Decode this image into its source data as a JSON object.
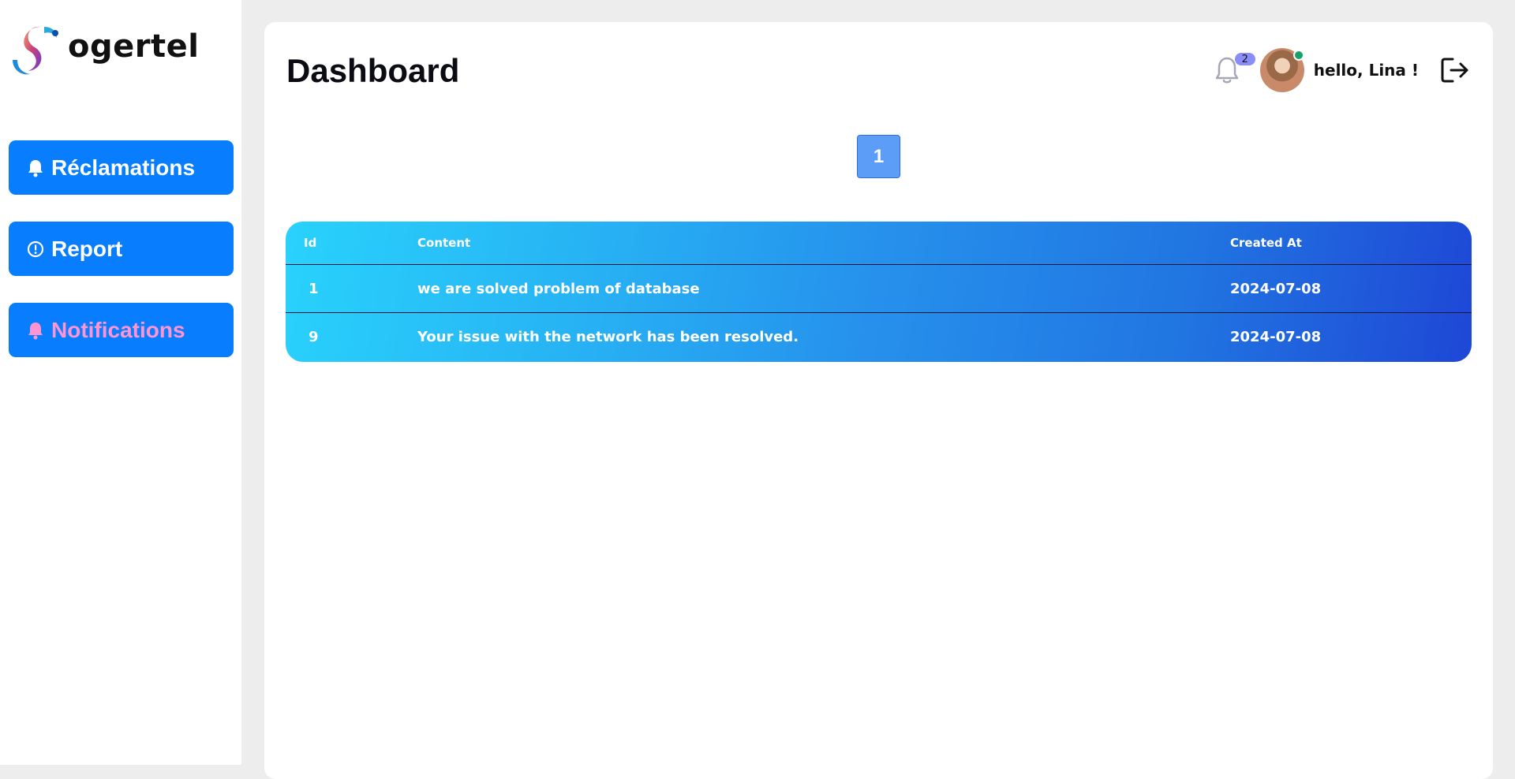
{
  "brand": {
    "name": "ogertel"
  },
  "sidebar": {
    "items": [
      {
        "label": "Réclamations",
        "icon": "bell-icon",
        "active": false
      },
      {
        "label": "Report",
        "icon": "exclamation-circle-icon",
        "active": false
      },
      {
        "label": "Notifications",
        "icon": "bell-icon",
        "active": true
      }
    ]
  },
  "header": {
    "title": "Dashboard",
    "notification_count": "2",
    "greeting": "hello, Lina !"
  },
  "pagination": {
    "current_page": "1"
  },
  "table": {
    "columns": [
      "Id",
      "Content",
      "Created At"
    ],
    "rows": [
      {
        "id": "1",
        "content": "we are solved problem of database",
        "created_at": "2024-07-08"
      },
      {
        "id": "9",
        "content": "Your issue with the network has been resolved.",
        "created_at": "2024-07-08"
      }
    ]
  },
  "colors": {
    "accent": "#087efe",
    "active_label": "#ff94d2",
    "table_gradient_start": "#29d2fc",
    "table_gradient_end": "#1e47d6",
    "badge": "#8a8cf8",
    "online": "#16a36a"
  }
}
